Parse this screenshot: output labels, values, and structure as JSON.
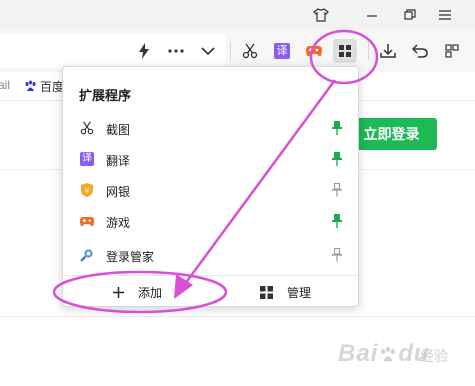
{
  "window": {
    "buttons": [
      {
        "name": "skin-icon"
      },
      {
        "name": "minimize-icon"
      },
      {
        "name": "restore-icon"
      },
      {
        "name": "menu-icon"
      }
    ]
  },
  "toolbar": {
    "items": [
      "lightning-icon",
      "more-icon",
      "chevron-down-icon",
      "scissors-icon",
      "translate-icon",
      "game-icon",
      "extensions-icon",
      "download-icon",
      "undo-icon"
    ]
  },
  "bookmarks": {
    "left_fragment": "ail",
    "baidu_label": "百度"
  },
  "page": {
    "login_label": "立即登录"
  },
  "popup": {
    "title": "扩展程序",
    "extensions": [
      {
        "name": "截图",
        "icon": "scissors-icon",
        "pinned": true
      },
      {
        "name": "翻译",
        "icon": "translate-icon",
        "icon_text": "译",
        "pinned": true
      },
      {
        "name": "网银",
        "icon": "shield-icon",
        "icon_text": "¥",
        "pinned": false
      },
      {
        "name": "游戏",
        "icon": "gamepad-icon",
        "pinned": true
      },
      {
        "name": "登录管家",
        "icon": "key-search-icon",
        "pinned": false
      }
    ],
    "add_label": "添加",
    "manage_label": "管理"
  },
  "colors": {
    "pinned": "#1aad4b",
    "unpinned": "#9a9a9a",
    "login_green": "#1db954",
    "annotation": "#d94fd6",
    "translate_purple": "#8a5cf6",
    "shield_orange": "#f5a623"
  },
  "watermark": {
    "brand": "Bai",
    "paw": "du",
    "sub": "经验"
  }
}
